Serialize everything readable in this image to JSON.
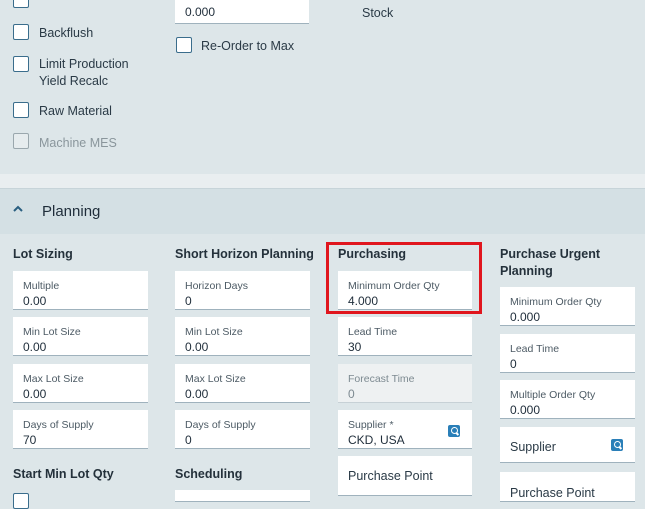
{
  "top": {
    "checkboxes": [
      {
        "label": "Backflush"
      },
      {
        "label": "Limit Production Yield Recalc",
        "line1": "Limit Production",
        "line2": "Yield Recalc"
      },
      {
        "label": "Raw Material"
      },
      {
        "label": "Machine MES",
        "disabled": true
      }
    ],
    "value_field": "0.000",
    "reorder_label": "Re-Order to Max",
    "stock_label": "Stock"
  },
  "planning": {
    "title": "Planning",
    "lot_sizing": {
      "heading": "Lot Sizing",
      "fields": [
        {
          "label": "Multiple",
          "value": "0.00"
        },
        {
          "label": "Min Lot Size",
          "value": "0.00"
        },
        {
          "label": "Max Lot Size",
          "value": "0.00"
        },
        {
          "label": "Days of Supply",
          "value": "70"
        }
      ],
      "next_heading": "Start Min Lot Qty"
    },
    "short_horizon": {
      "heading": "Short Horizon Planning",
      "fields": [
        {
          "label": "Horizon Days",
          "value": "0"
        },
        {
          "label": "Min Lot Size",
          "value": "0.00"
        },
        {
          "label": "Max Lot Size",
          "value": "0.00"
        },
        {
          "label": "Days of Supply",
          "value": "0"
        }
      ],
      "next_heading": "Scheduling"
    },
    "purchasing": {
      "heading": "Purchasing",
      "min_order": {
        "label": "Minimum Order Qty",
        "value": "4.000"
      },
      "lead_time": {
        "label": "Lead Time",
        "value": "30"
      },
      "forecast_time": {
        "label": "Forecast Time",
        "value": "0"
      },
      "supplier": {
        "label": "Supplier *",
        "value": "CKD, USA"
      },
      "purchase_point": "Purchase Point"
    },
    "purchase_urgent": {
      "heading_line1": "Purchase Urgent",
      "heading_line2": "Planning",
      "min_order": {
        "label": "Minimum Order Qty",
        "value": "0.000"
      },
      "lead_time": {
        "label": "Lead Time",
        "value": "0"
      },
      "multiple_order": {
        "label": "Multiple Order Qty",
        "value": "0.000"
      },
      "supplier": "Supplier",
      "purchase_point": "Purchase Point"
    }
  },
  "colors": {
    "highlight": "#e0161e",
    "accent": "#2a7fb8"
  }
}
